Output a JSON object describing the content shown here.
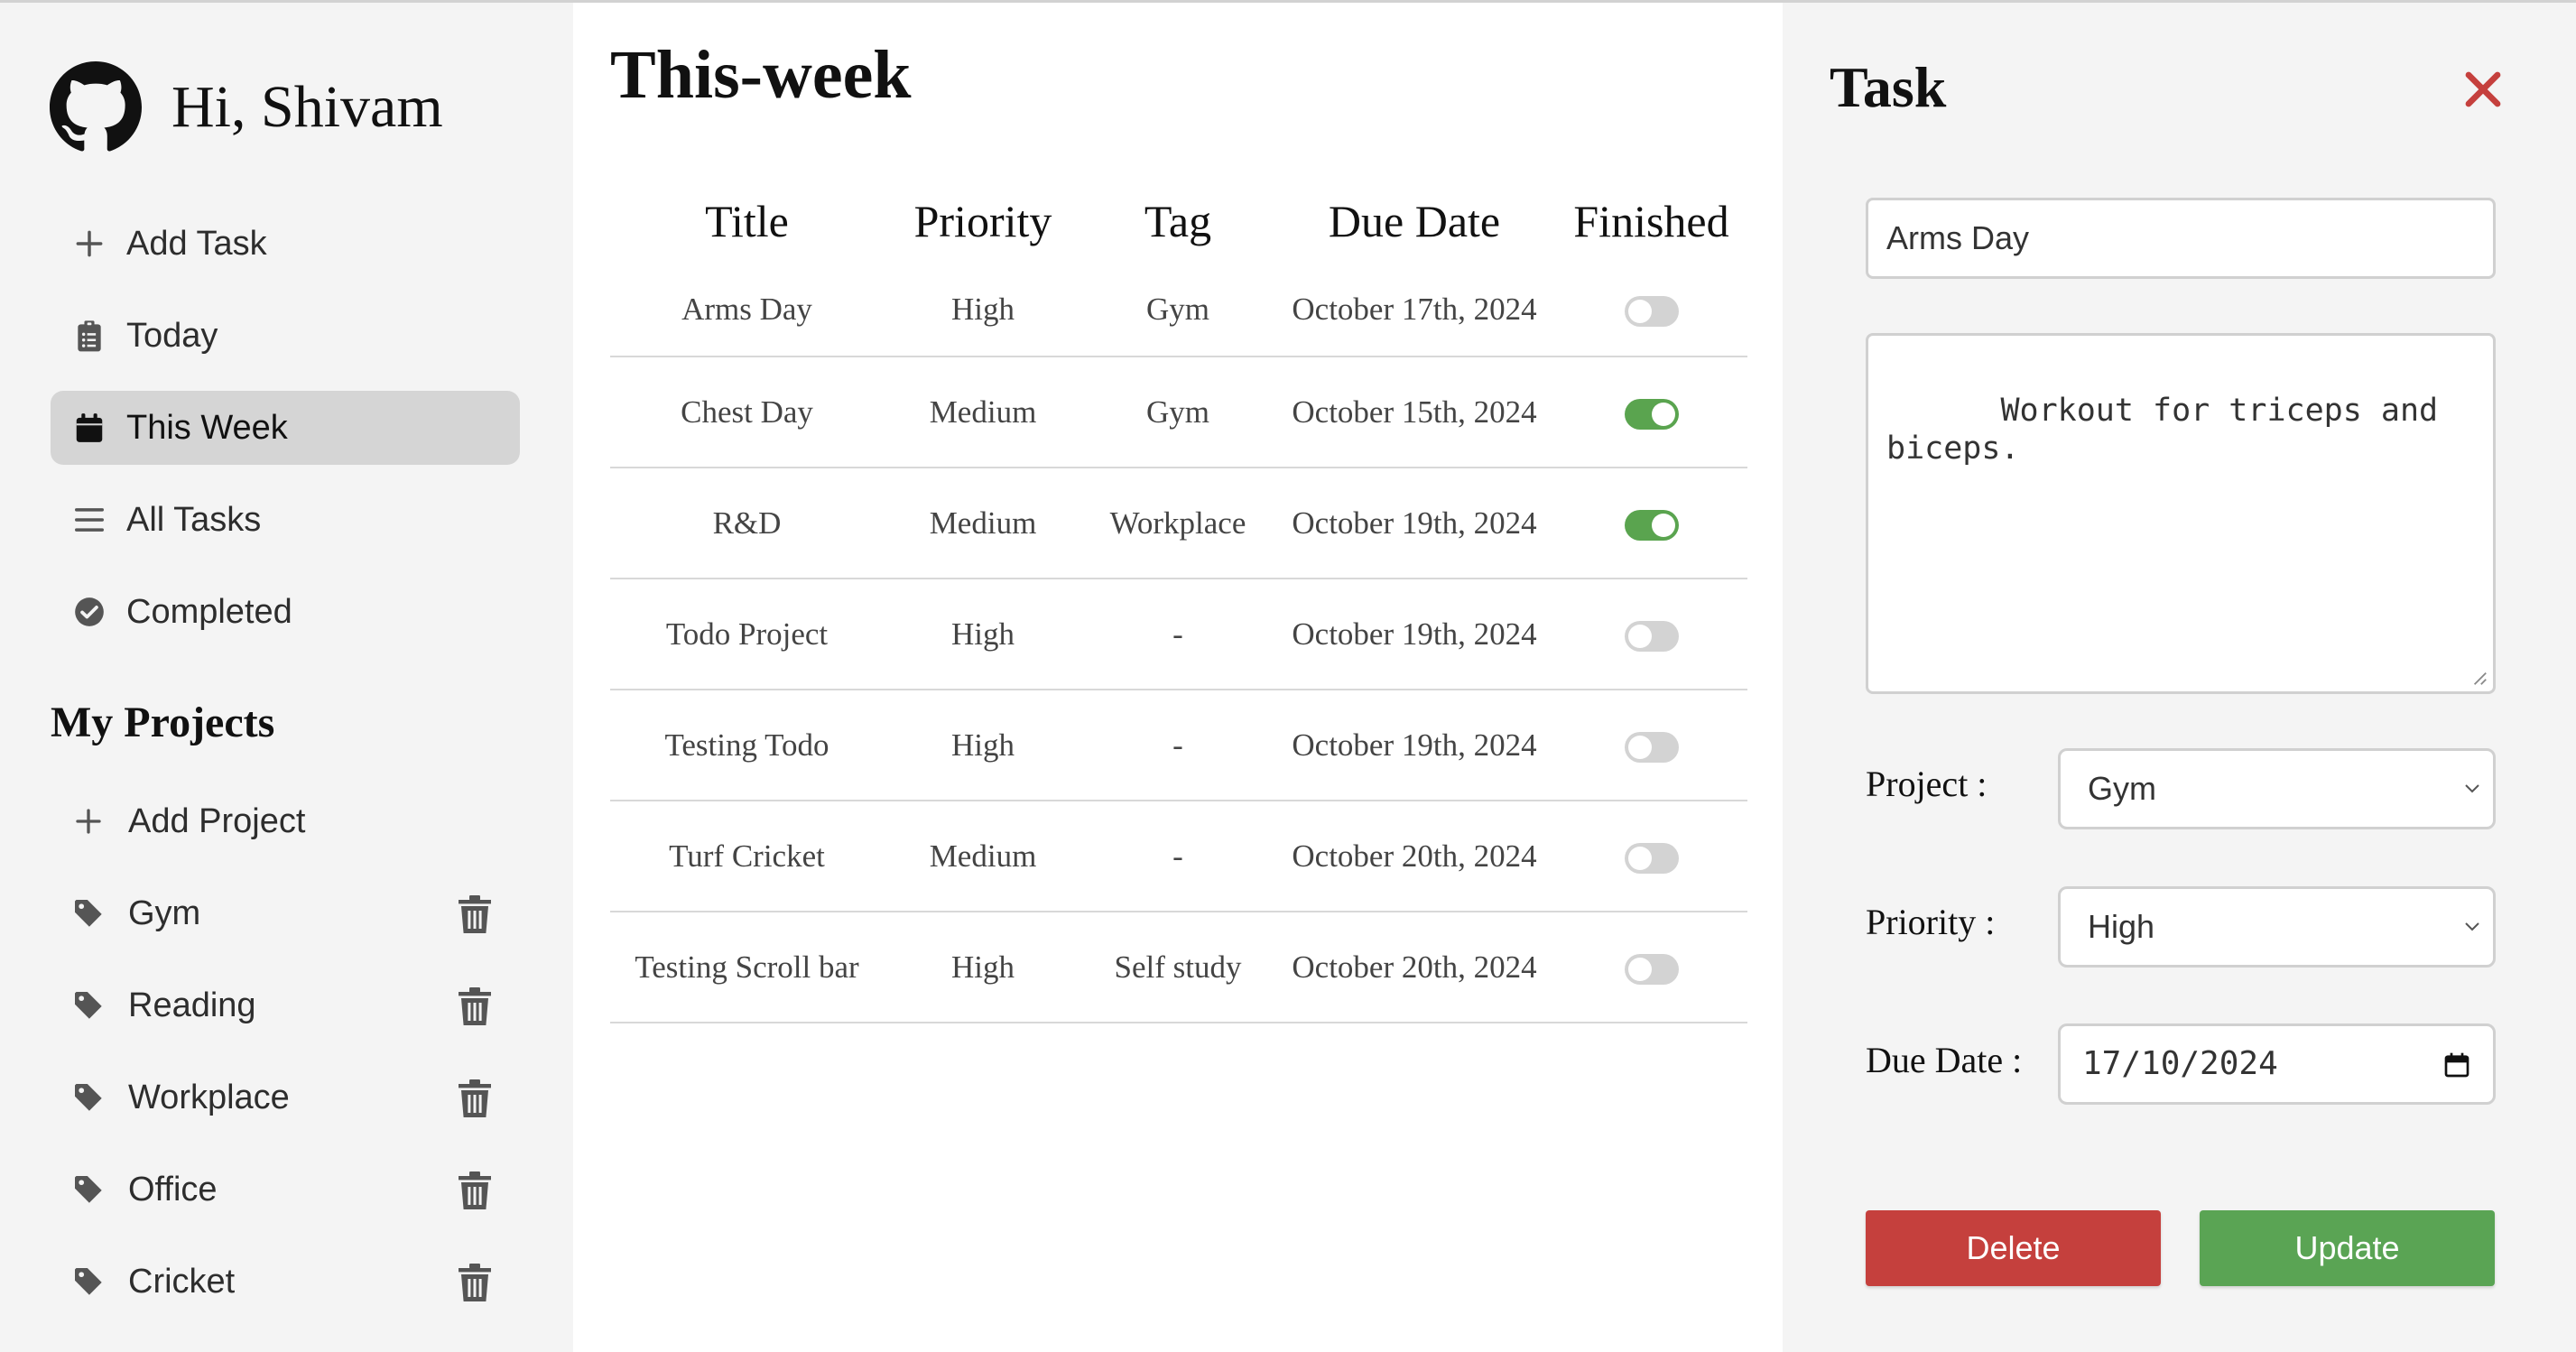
{
  "user": {
    "greeting": "Hi, Shivam"
  },
  "nav": {
    "items": [
      {
        "label": "Add Task",
        "icon": "plus-icon"
      },
      {
        "label": "Today",
        "icon": "clipboard-icon"
      },
      {
        "label": "This Week",
        "icon": "calendar-icon",
        "active": true
      },
      {
        "label": "All Tasks",
        "icon": "list-icon"
      },
      {
        "label": "Completed",
        "icon": "check-circle-icon"
      }
    ]
  },
  "projects": {
    "title": "My Projects",
    "add_label": "Add Project",
    "items": [
      {
        "label": "Gym"
      },
      {
        "label": "Reading"
      },
      {
        "label": "Workplace"
      },
      {
        "label": "Office"
      },
      {
        "label": "Cricket"
      }
    ]
  },
  "main": {
    "title": "This-week",
    "columns": [
      "Title",
      "Priority",
      "Tag",
      "Due Date",
      "Finished"
    ],
    "rows": [
      {
        "title": "Arms Day",
        "priority": "High",
        "tag": "Gym",
        "due": "October 17th, 2024",
        "finished": false
      },
      {
        "title": "Chest Day",
        "priority": "Medium",
        "tag": "Gym",
        "due": "October 15th, 2024",
        "finished": true
      },
      {
        "title": "R&D",
        "priority": "Medium",
        "tag": "Workplace",
        "due": "October 19th, 2024",
        "finished": true
      },
      {
        "title": "Todo Project",
        "priority": "High",
        "tag": "-",
        "due": "October 19th, 2024",
        "finished": false
      },
      {
        "title": "Testing Todo",
        "priority": "High",
        "tag": "-",
        "due": "October 19th, 2024",
        "finished": false
      },
      {
        "title": "Turf Cricket",
        "priority": "Medium",
        "tag": "-",
        "due": "October 20th, 2024",
        "finished": false
      },
      {
        "title": "Testing Scroll bar",
        "priority": "High",
        "tag": "Self study",
        "due": "October 20th, 2024",
        "finished": false
      }
    ]
  },
  "panel": {
    "title": "Task",
    "task_title": "Arms Day",
    "description": "Workout for triceps and\nbiceps.",
    "project_label": "Project :",
    "project_value": "Gym",
    "priority_label": "Priority :",
    "priority_value": "High",
    "due_label": "Due Date :",
    "due_value": "17/10/2024",
    "delete_label": "Delete",
    "update_label": "Update"
  },
  "colors": {
    "sidebar_bg": "#f4f4f4",
    "active_bg": "#d5d5d5",
    "toggle_on": "#5aa44f",
    "toggle_off": "#d3d3d3",
    "delete": "#c5403d",
    "update": "#5aa454",
    "close": "#c5403d"
  }
}
